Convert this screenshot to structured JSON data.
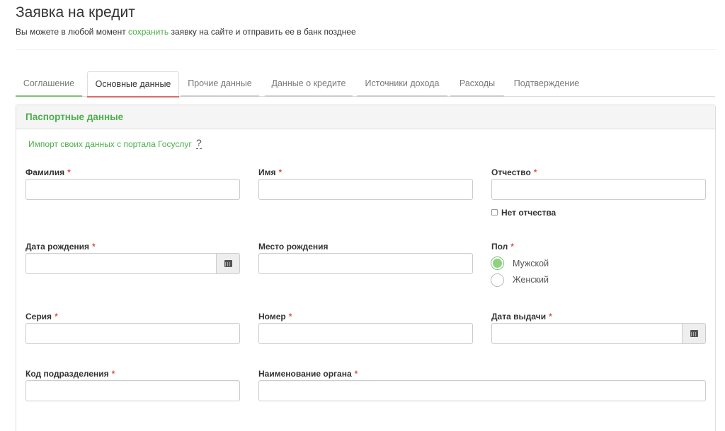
{
  "header": {
    "title": "Заявка на кредит",
    "subtitle_before": "Вы можете в любой момент ",
    "subtitle_link": "сохранить",
    "subtitle_after": " заявку на сайте и отправить ее в банк позднее"
  },
  "tabs": [
    {
      "label": "Соглашение",
      "state": "done"
    },
    {
      "label": "Основные данные",
      "state": "active"
    },
    {
      "label": "Прочие данные",
      "state": "pending"
    },
    {
      "label": "Данные о кредите",
      "state": "pending"
    },
    {
      "label": "Источники дохода",
      "state": "pending"
    },
    {
      "label": "Расходы",
      "state": "pending"
    },
    {
      "label": "Подтверждение",
      "state": "none"
    }
  ],
  "panel": {
    "heading": "Паспортные данные",
    "import_link": "Импорт своих данных с портала Госуслуг",
    "help": "?"
  },
  "form": {
    "surname": {
      "label": "Фамилия",
      "value": ""
    },
    "name": {
      "label": "Имя",
      "value": ""
    },
    "patronymic": {
      "label": "Отчество",
      "value": ""
    },
    "no_patronymic": {
      "label": "Нет отчества",
      "checked": false
    },
    "birth_date": {
      "label": "Дата рождения",
      "value": ""
    },
    "birth_place": {
      "label": "Место рождения",
      "value": ""
    },
    "gender": {
      "label": "Пол",
      "options": [
        "Мужской",
        "Женский"
      ],
      "selected": "Мужской"
    },
    "series": {
      "label": "Серия",
      "value": ""
    },
    "number": {
      "label": "Номер",
      "value": ""
    },
    "issue_date": {
      "label": "Дата выдачи",
      "value": ""
    },
    "division_code": {
      "label": "Код подразделения",
      "value": ""
    },
    "authority_name": {
      "label": "Наименование органа",
      "value": ""
    },
    "required_mark": "*"
  },
  "colors": {
    "accent": "#4cae4c",
    "required": "#d9534f",
    "active_tab_underline": "#e06a6a",
    "done_tab_underline": "#7cc576"
  },
  "icons": {
    "calendar": "calendar-icon"
  }
}
